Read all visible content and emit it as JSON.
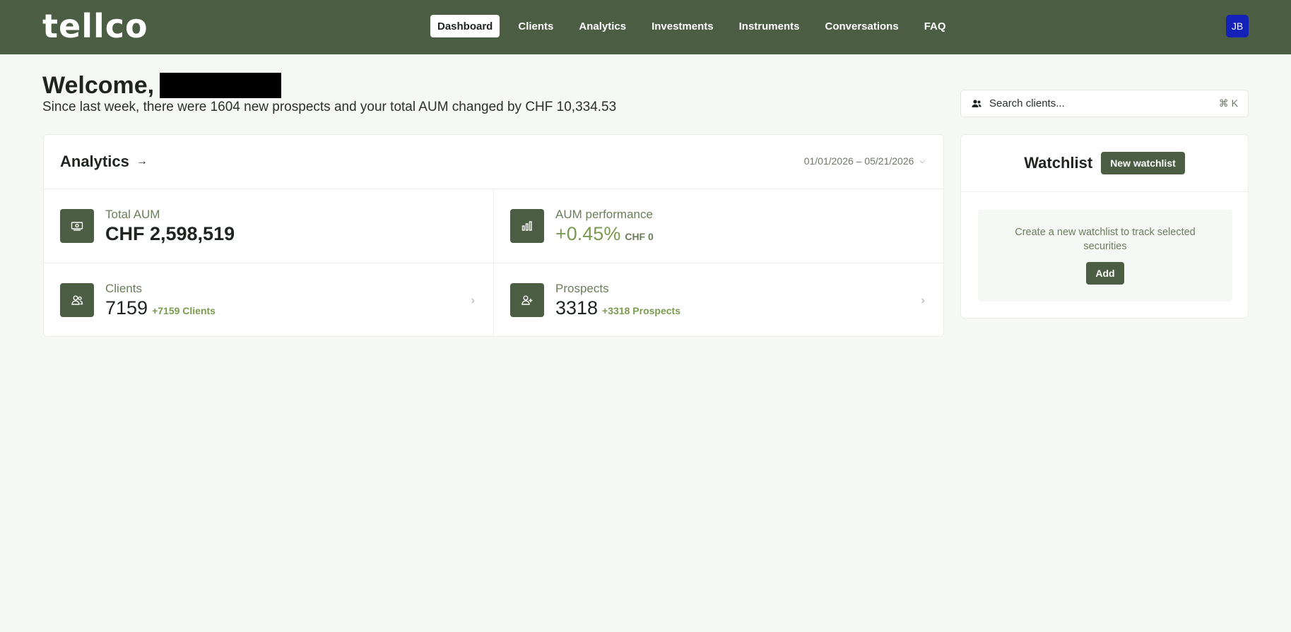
{
  "header": {
    "logo": "tellco",
    "nav": [
      "Dashboard",
      "Clients",
      "Analytics",
      "Investments",
      "Instruments",
      "Conversations",
      "FAQ"
    ],
    "active_nav": "Dashboard",
    "avatar_initials": "JB",
    "brand_color": "#4b5d43",
    "avatar_color": "#1421b8"
  },
  "welcome": {
    "greeting": "Welcome,",
    "subtitle": "Since last week, there were 1604 new prospects and your total AUM changed by CHF 10,334.53"
  },
  "search": {
    "placeholder": "Search clients...",
    "shortcut": "⌘ K",
    "icon": "users-icon"
  },
  "analytics": {
    "title": "Analytics",
    "arrow": "→",
    "date_range": "01/01/2026 – 05/21/2026",
    "metrics": [
      {
        "label": "Total AUM",
        "value": "CHF 2,598,519",
        "delta": "",
        "icon": "money-icon"
      },
      {
        "label": "AUM performance",
        "value": "+0.45%",
        "delta": "CHF 0",
        "icon": "bar-chart-icon"
      },
      {
        "label": "Clients",
        "value": "7159",
        "delta": "+7159 Clients",
        "icon": "users-icon"
      },
      {
        "label": "Prospects",
        "value": "3318",
        "delta": "+3318 Prospects",
        "icon": "user-plus-icon"
      }
    ]
  },
  "watchlist": {
    "title": "Watchlist",
    "new_button": "New watchlist",
    "empty_text": "Create a new watchlist to track selected securities",
    "add_button": "Add"
  }
}
